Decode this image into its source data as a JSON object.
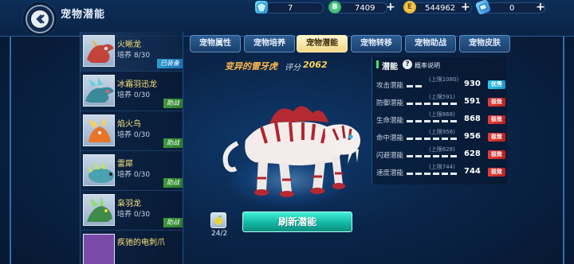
{
  "header": {
    "title": "宠物潜能"
  },
  "resources": [
    {
      "icon": "blue-crystal-icon",
      "value": "7"
    },
    {
      "icon": "green-b-coin-icon",
      "value": "7409"
    },
    {
      "icon": "gold-e-coin-icon",
      "value": "544962"
    },
    {
      "icon": "blue-ticket-icon",
      "value": "0"
    }
  ],
  "pets": [
    {
      "name": "火晰龙",
      "train": "培养 8/30",
      "tag": "已装备"
    },
    {
      "name": "冰霜羽迅龙",
      "train": "培养 0/30",
      "tag": "助战"
    },
    {
      "name": "焰火鸟",
      "train": "培养 0/30",
      "tag": "助战"
    },
    {
      "name": "雷犀",
      "train": "培养 0/30",
      "tag": "助战"
    },
    {
      "name": "枭羽龙",
      "train": "培养 0/30",
      "tag": "助战"
    },
    {
      "name": "疾驰的电刺爪",
      "train": "",
      "tag": ""
    }
  ],
  "tabs": [
    "宠物属性",
    "宠物培养",
    "宠物潜能",
    "宠物转移",
    "宠物助战",
    "宠物皮肤"
  ],
  "active_tab": 2,
  "pet": {
    "title": "变异的雷牙虎",
    "score_label": "评分",
    "score": "2062"
  },
  "item": {
    "count": "24/2"
  },
  "refresh_label": "刷新潜能",
  "potential": {
    "header": "潜能",
    "help": "?",
    "prob_link": "概率说明",
    "rows": [
      {
        "name": "攻击潜能",
        "cap": "(上限1080)",
        "value": "930",
        "badge": "优秀",
        "badge_type": "excellent",
        "fill": 0.3
      },
      {
        "name": "防御潜能",
        "cap": "(上限591)",
        "value": "591",
        "badge": "极致",
        "badge_type": "extreme",
        "fill": 1.0
      },
      {
        "name": "生命潜能",
        "cap": "(上限868)",
        "value": "868",
        "badge": "极致",
        "badge_type": "extreme",
        "fill": 1.0
      },
      {
        "name": "命中潜能",
        "cap": "(上限956)",
        "value": "956",
        "badge": "极致",
        "badge_type": "extreme",
        "fill": 1.0
      },
      {
        "name": "闪避潜能",
        "cap": "(上限628)",
        "value": "628",
        "badge": "极致",
        "badge_type": "extreme",
        "fill": 1.0
      },
      {
        "name": "速度潜能",
        "cap": "(上限744)",
        "value": "744",
        "badge": "极致",
        "badge_type": "extreme",
        "fill": 1.0
      }
    ]
  },
  "colors": {
    "accent_teal": "#14b7a4",
    "badge_excellent": "#2fc8ea",
    "badge_extreme": "#e4403c",
    "pet_name_yellow": "#ffe27a",
    "title_orange": "#ffb74a"
  }
}
